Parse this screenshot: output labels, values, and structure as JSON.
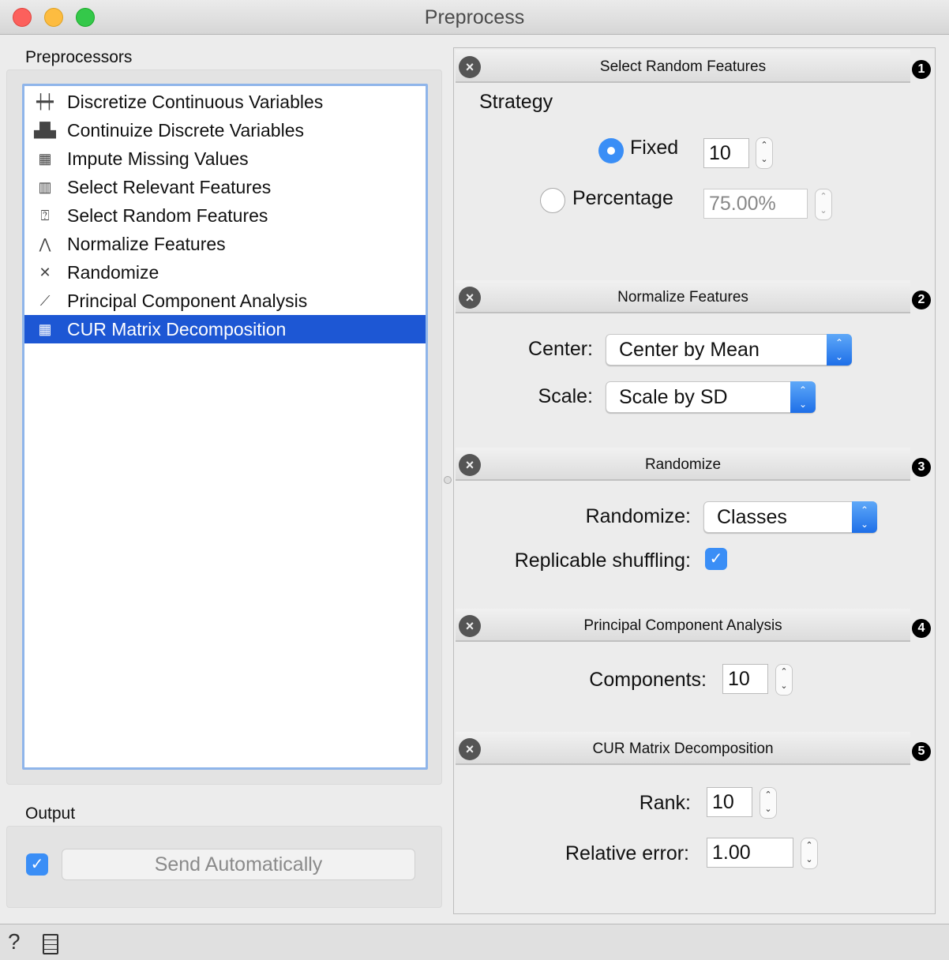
{
  "window": {
    "title": "Preprocess"
  },
  "left": {
    "label": "Preprocessors",
    "items": [
      {
        "label": "Discretize Continuous Variables",
        "icon": "discretize-icon"
      },
      {
        "label": "Continuize Discrete Variables",
        "icon": "continuize-icon"
      },
      {
        "label": "Impute Missing Values",
        "icon": "impute-icon"
      },
      {
        "label": "Select Relevant Features",
        "icon": "select-relevant-icon"
      },
      {
        "label": "Select Random Features",
        "icon": "select-random-icon"
      },
      {
        "label": "Normalize Features",
        "icon": "normalize-icon"
      },
      {
        "label": "Randomize",
        "icon": "randomize-icon"
      },
      {
        "label": "Principal Component Analysis",
        "icon": "pca-icon"
      },
      {
        "label": "CUR Matrix Decomposition",
        "icon": "cur-icon",
        "selected": true
      }
    ]
  },
  "sections": [
    {
      "title": "Select Random Features",
      "num": "1",
      "strategy_label": "Strategy",
      "fixed_label": "Fixed",
      "fixed_value": "10",
      "percentage_label": "Percentage",
      "percentage_value": "75.00%",
      "selected": "Fixed"
    },
    {
      "title": "Normalize Features",
      "num": "2",
      "center_label": "Center:",
      "center_value": "Center by Mean",
      "scale_label": "Scale:",
      "scale_value": "Scale by SD"
    },
    {
      "title": "Randomize",
      "num": "3",
      "randomize_label": "Randomize:",
      "randomize_value": "Classes",
      "replicable_label": "Replicable shuffling:",
      "replicable_checked": true
    },
    {
      "title": "Principal Component Analysis",
      "num": "4",
      "components_label": "Components:",
      "components_value": "10"
    },
    {
      "title": "CUR Matrix Decomposition",
      "num": "5",
      "rank_label": "Rank:",
      "rank_value": "10",
      "error_label": "Relative error:",
      "error_value": "1.00"
    }
  ],
  "output": {
    "label": "Output",
    "send_label": "Send Automatically",
    "auto_checked": true
  },
  "colors": {
    "accent": "#1d57d4",
    "check": "#3a8ef6"
  }
}
